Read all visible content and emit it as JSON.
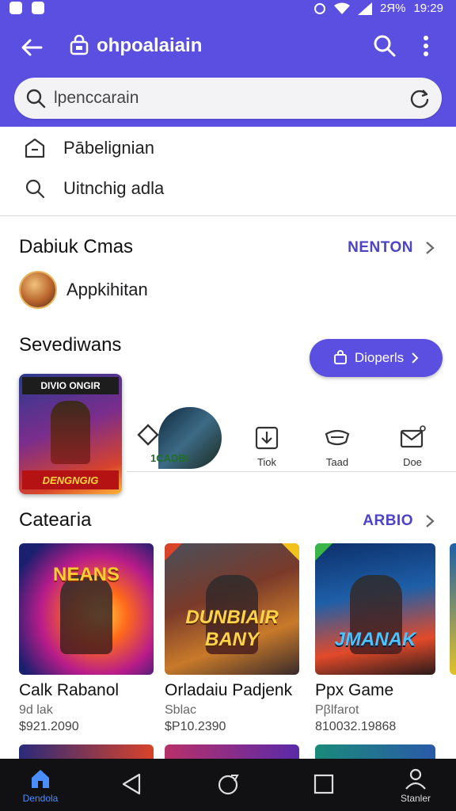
{
  "status": {
    "battery": "2Я%",
    "time": "19:29"
  },
  "appbar": {
    "title": "ohpoalaiain"
  },
  "search": {
    "value": "lpenccarain"
  },
  "suggestions": [
    {
      "label": "Pābelignian"
    },
    {
      "label": "Uitnchig adla"
    }
  ],
  "section1": {
    "title": "Dabiuk Cmas",
    "link": "NENTON",
    "app_name": "Appkihitan"
  },
  "section2": {
    "title": "Sevediwans",
    "button": "Dioperls"
  },
  "featured": {
    "tag": "DIVIO ONGIR",
    "banner": "DENGNGIG"
  },
  "quick": [
    {
      "label": "1CADBI"
    },
    {
      "label": "Tiok"
    },
    {
      "label": "Taad"
    },
    {
      "label": "Doe"
    }
  ],
  "categories": {
    "title": "Cateaгia",
    "link": "ARBIO"
  },
  "cards": [
    {
      "art_text": "NEANS",
      "name": "Calk Rabanol",
      "sub": "9d lak",
      "price": "$921.2090"
    },
    {
      "art_text": "DUNBIAIR BANY",
      "name": "Orladaiu Padjenk",
      "sub": "Sblac",
      "price": "$P10.2390"
    },
    {
      "art_text": "JMANAK",
      "name": "Ppx Game",
      "sub": "Pβlfarot",
      "price": "810032.19868"
    }
  ],
  "nav": {
    "home": "Dendola",
    "profile": "Stanler"
  },
  "colors": {
    "primary": "#5a4fe0",
    "accent_text": "#4c43c9",
    "nav_bg": "#111114",
    "nav_active": "#4a8dff"
  }
}
